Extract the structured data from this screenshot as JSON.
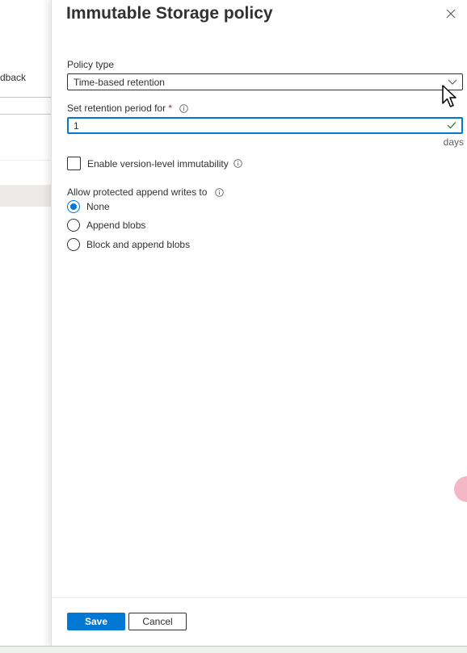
{
  "background": {
    "feedback_text": "dback"
  },
  "panel": {
    "title": "Immutable Storage policy",
    "policy_type": {
      "label": "Policy type",
      "selected": "Time-based retention"
    },
    "retention": {
      "label": "Set retention period for",
      "required_marker": "*",
      "value": "1",
      "units": "days"
    },
    "version_level": {
      "label": "Enable version-level immutability",
      "checked": false
    },
    "append_writes": {
      "label": "Allow protected append writes to",
      "options": [
        {
          "label": "None",
          "selected": true
        },
        {
          "label": "Append blobs",
          "selected": false
        },
        {
          "label": "Block and append blobs",
          "selected": false
        }
      ]
    },
    "footer": {
      "save_label": "Save",
      "cancel_label": "Cancel"
    }
  },
  "colors": {
    "accent": "#0078d4",
    "required": "#a4262c",
    "success": "#107c10"
  }
}
